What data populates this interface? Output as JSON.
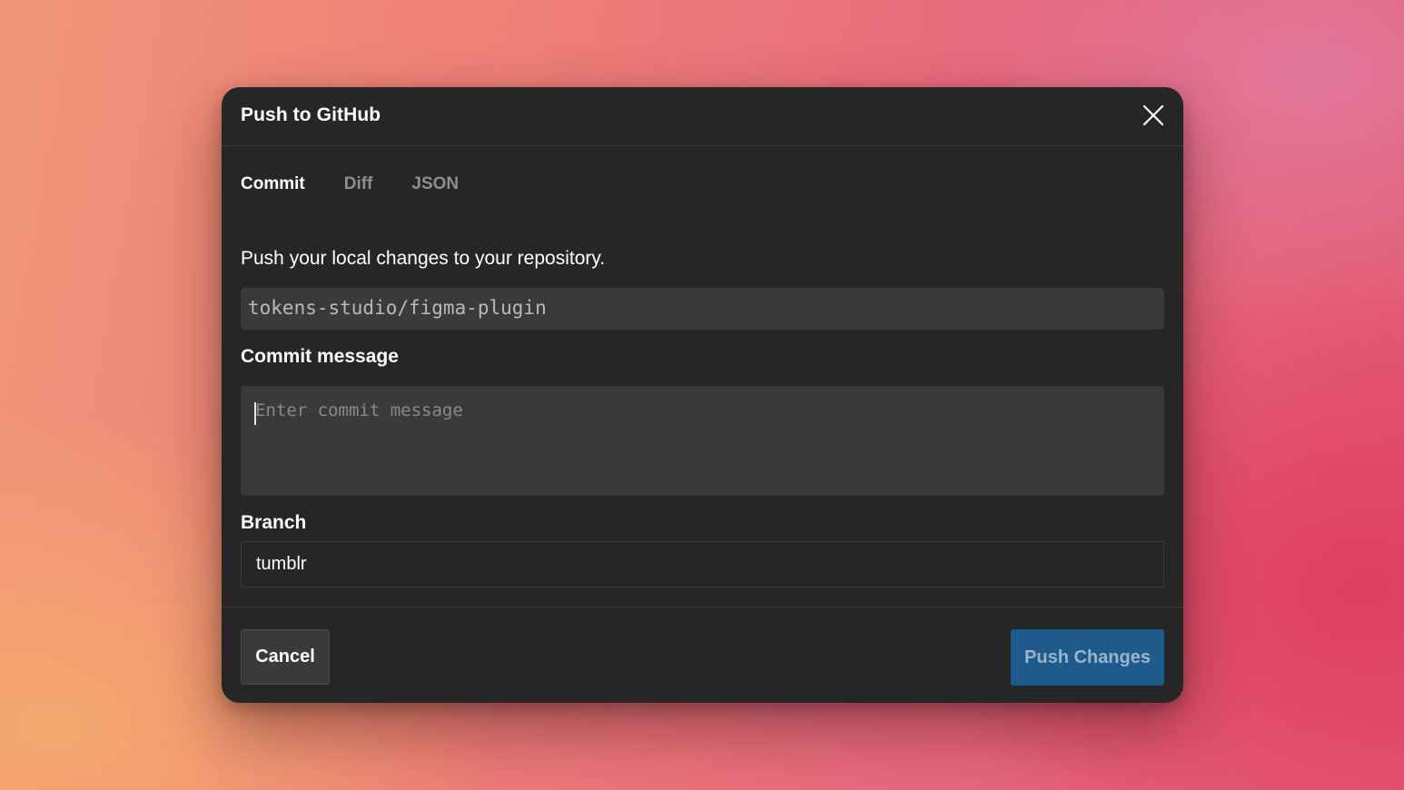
{
  "dialog": {
    "title": "Push to GitHub",
    "close_icon": "close-icon"
  },
  "tabs": [
    {
      "label": "Commit",
      "active": true
    },
    {
      "label": "Diff",
      "active": false
    },
    {
      "label": "JSON",
      "active": false
    }
  ],
  "commit": {
    "description": "Push your local changes to your repository.",
    "repository": "tokens-studio/figma-plugin",
    "message_label": "Commit message",
    "message_placeholder": "Enter commit message",
    "message_value": "",
    "branch_label": "Branch",
    "branch_value": "tumblr"
  },
  "footer": {
    "cancel_label": "Cancel",
    "push_label": "Push Changes"
  },
  "colors": {
    "dialog_bg": "#262626",
    "input_bg": "#3a3a3a",
    "primary": "#1e5a8c"
  }
}
